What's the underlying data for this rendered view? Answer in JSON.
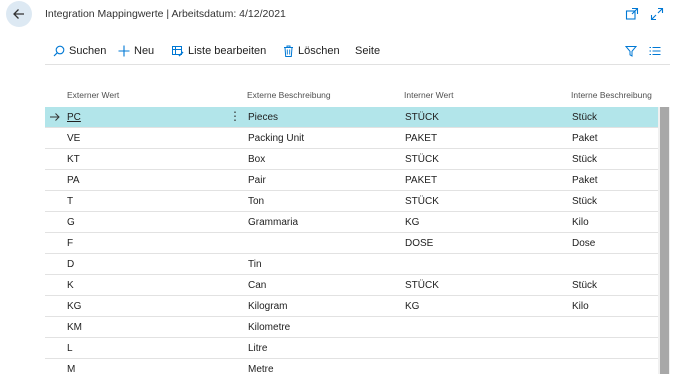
{
  "header": {
    "title": "Integration Mappingwerte | Arbeitsdatum: 4/12/2021"
  },
  "actions": {
    "search": "Suchen",
    "new": "Neu",
    "edit_list": "Liste bearbeiten",
    "delete": "Löschen",
    "page": "Seite"
  },
  "columns": [
    "Externer Wert",
    "Externe Beschreibung",
    "Interner Wert",
    "Interne Beschreibung"
  ],
  "rows": [
    {
      "ext": "PC",
      "ext_desc": "Pieces",
      "int": "STÜCK",
      "int_desc": "Stück"
    },
    {
      "ext": "VE",
      "ext_desc": "Packing Unit",
      "int": "PAKET",
      "int_desc": "Paket"
    },
    {
      "ext": "KT",
      "ext_desc": "Box",
      "int": "STÜCK",
      "int_desc": "Stück"
    },
    {
      "ext": "PA",
      "ext_desc": "Pair",
      "int": "PAKET",
      "int_desc": "Paket"
    },
    {
      "ext": "T",
      "ext_desc": "Ton",
      "int": "STÜCK",
      "int_desc": "Stück"
    },
    {
      "ext": "G",
      "ext_desc": "Grammaria",
      "int": "KG",
      "int_desc": "Kilo"
    },
    {
      "ext": "F",
      "ext_desc": "",
      "int": "DOSE",
      "int_desc": "Dose"
    },
    {
      "ext": "D",
      "ext_desc": "Tin",
      "int": "",
      "int_desc": ""
    },
    {
      "ext": "K",
      "ext_desc": "Can",
      "int": "STÜCK",
      "int_desc": "Stück"
    },
    {
      "ext": "KG",
      "ext_desc": "Kilogram",
      "int": "KG",
      "int_desc": "Kilo"
    },
    {
      "ext": "KM",
      "ext_desc": "Kilometre",
      "int": "",
      "int_desc": ""
    },
    {
      "ext": "L",
      "ext_desc": "Litre",
      "int": "",
      "int_desc": ""
    },
    {
      "ext": "M",
      "ext_desc": "Metre",
      "int": "",
      "int_desc": ""
    }
  ],
  "colors": {
    "accent": "#0078d4",
    "selected_row": "#b2e5ea",
    "back_button": "#dde9f3"
  },
  "icons": [
    "back-arrow-icon",
    "open-new-window-icon",
    "expand-icon",
    "search-icon",
    "plus-icon",
    "edit-list-icon",
    "trash-icon",
    "filter-icon",
    "list-view-icon",
    "row-arrow-icon",
    "more-options-icon"
  ]
}
